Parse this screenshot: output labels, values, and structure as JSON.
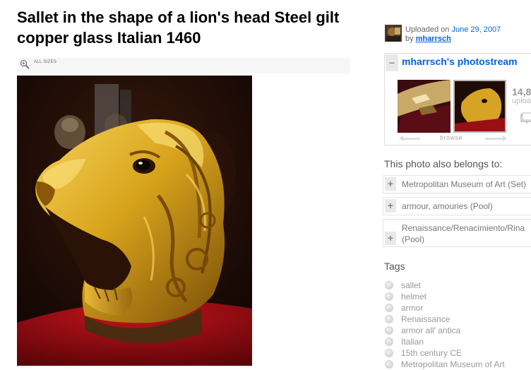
{
  "photo_title": "Sallet in the shape of a lion's head Steel gilt copper glass Italian 1460",
  "all_sizes_label": "ALL SIZES",
  "photo_alt": "Gilded lion head sallet on display",
  "uploader": {
    "uploaded_prefix": "Uploaded on",
    "date": "June 29, 2007",
    "by_prefix": "by",
    "owner": "mharrsch"
  },
  "photostream": {
    "title": "mharrsch's photostream",
    "count": "14,8",
    "count_sub": "uploa",
    "browse_label": "browse"
  },
  "belongs": {
    "heading": "This photo also belongs to:",
    "sets": [
      {
        "name": "Metropolitan Museum of Art (Set)"
      },
      {
        "name": "armour, amouries (Pool)"
      },
      {
        "name": "Renaissance/Renacimiento/Rina",
        "name2": "(Pool)"
      }
    ]
  },
  "tags": {
    "heading": "Tags",
    "items": [
      "sallet",
      "helmet",
      "armor",
      "Renaissance",
      "armor all' antica",
      "Italian",
      "15th century CE",
      "Metropolitan Museum of Art"
    ]
  },
  "colors": {
    "link": "#0063dc",
    "gold": "#d8a41c",
    "muted": "#999999"
  }
}
